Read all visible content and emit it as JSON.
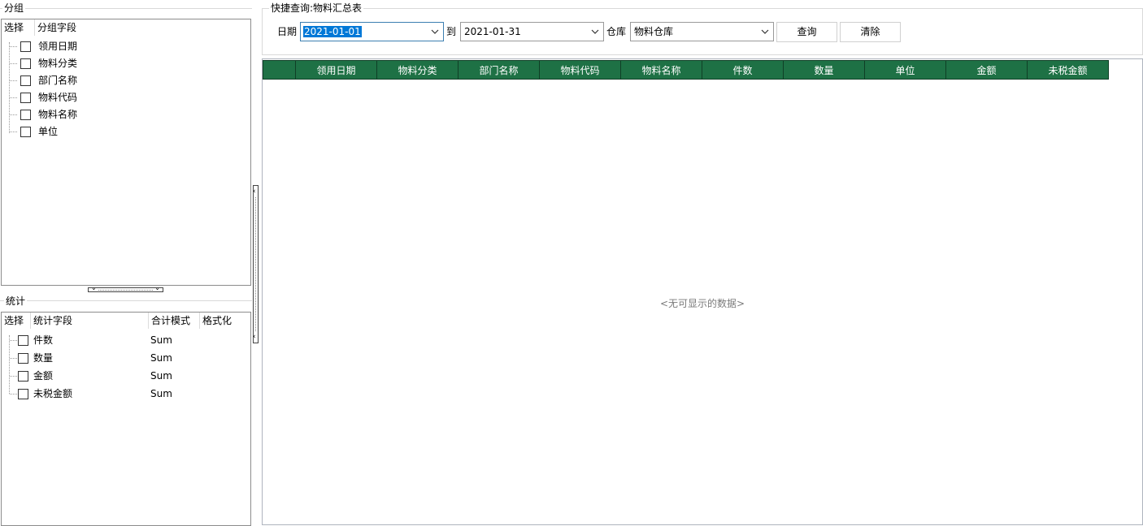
{
  "group_panel": {
    "title": "分组",
    "col_select": "选择",
    "col_field": "分组字段",
    "items": [
      {
        "label": "领用日期",
        "checked": false
      },
      {
        "label": "物料分类",
        "checked": false
      },
      {
        "label": "部门名称",
        "checked": false
      },
      {
        "label": "物料代码",
        "checked": false
      },
      {
        "label": "物料名称",
        "checked": false
      },
      {
        "label": "单位",
        "checked": false
      }
    ]
  },
  "stats_panel": {
    "title": "统计",
    "col_select": "选择",
    "col_field": "统计字段",
    "col_mode": "合计模式",
    "col_format": "格式化",
    "items": [
      {
        "label": "件数",
        "mode": "Sum",
        "checked": false
      },
      {
        "label": "数量",
        "mode": "Sum",
        "checked": false
      },
      {
        "label": "金额",
        "mode": "Sum",
        "checked": false
      },
      {
        "label": "未税金额",
        "mode": "Sum",
        "checked": false
      }
    ]
  },
  "query": {
    "title": "快捷查询:物料汇总表",
    "date_label": "日期",
    "date_from": "2021-01-01",
    "to_label": "到",
    "date_to": "2021-01-31",
    "warehouse_label": "仓库",
    "warehouse": "物料仓库",
    "query_button": "查询",
    "clear_button": "清除"
  },
  "grid": {
    "columns": [
      "",
      "领用日期",
      "物料分类",
      "部门名称",
      "物料代码",
      "物料名称",
      "件数",
      "数量",
      "单位",
      "金额",
      "未税金额"
    ],
    "empty_text": "<无可显示的数据>"
  },
  "colors": {
    "header_bg": "#1e7145",
    "selection": "#0078d7"
  }
}
